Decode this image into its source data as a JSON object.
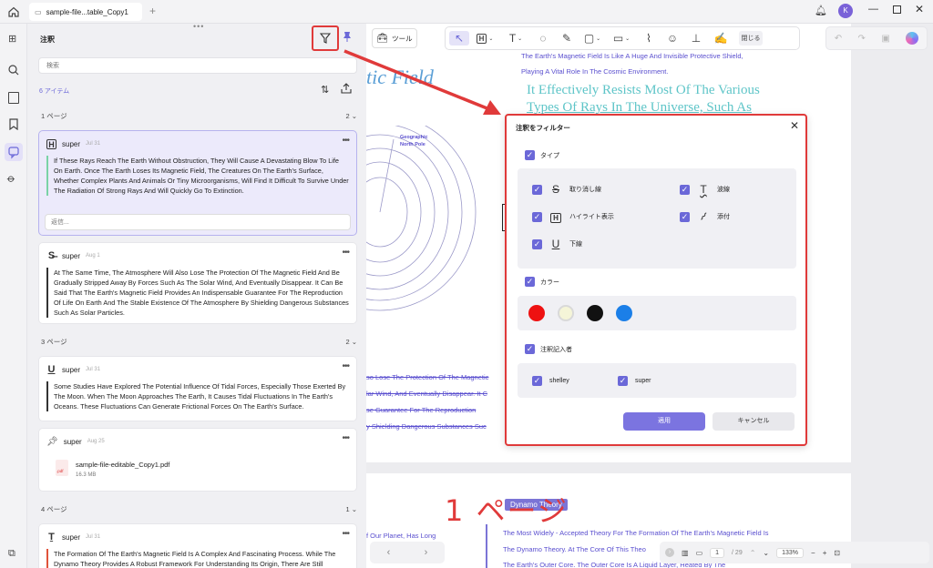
{
  "tab": {
    "title": "sample-file...table_Copy1",
    "new_tab": "+"
  },
  "user": {
    "initial": "K"
  },
  "panel": {
    "title": "注釈",
    "search_placeholder": "検索",
    "count": "6 アイテム",
    "sections": [
      {
        "label": "1 ページ",
        "count": "2"
      },
      {
        "label": "3 ページ",
        "count": "2"
      },
      {
        "label": "4 ページ",
        "count": "1"
      }
    ],
    "cards": [
      {
        "icon": "H",
        "author": "super",
        "date": "Jul 31",
        "body": "If These Rays Reach The Earth Without Obstruction, They Will Cause A Devastating Blow To Life On Earth. Once The Earth Loses Its Magnetic Field, The Creatures On The Earth's Surface, Whether Complex Plants And Animals Or Tiny Microorganisms, Will Find It Difficult To Survive Under The Radiation Of Strong Rays And Will Quickly Go To Extinction.",
        "reply_placeholder": "返信..."
      },
      {
        "icon": "S",
        "author": "super",
        "date": "Aug 1",
        "body": "At The Same Time, The Atmosphere Will Also Lose The Protection Of The Magnetic Field And Be Gradually Stripped Away By Forces Such As The Solar Wind, And Eventually Disappear. It Can Be Said That The Earth's Magnetic Field Provides An Indispensable Guarantee For The Reproduction Of Life On Earth And The Stable Existence Of The Atmosphere By Shielding Dangerous Substances Such As Solar Particles."
      },
      {
        "icon": "U",
        "author": "super",
        "date": "Jul 31",
        "body": "Some Studies Have Explored The Potential Influence Of Tidal Forces, Especially Those Exerted By The Moon. When The Moon Approaches The Earth, It Causes Tidal Fluctuations In The Earth's Oceans. These Fluctuations Can Generate Frictional Forces On The Earth's Surface."
      },
      {
        "icon": "pin",
        "author": "super",
        "date": "Aug 25",
        "file_name": "sample-file-editable_Copy1.pdf",
        "file_size": "16.3 MB",
        "file_ext": ".pdf"
      },
      {
        "icon": "T",
        "author": "super",
        "date": "Jul 31",
        "body": "The Formation Of The Earth's Magnetic Field Is A Complex And Fascinating Process. While The Dynamo Theory Provides A Robust Framework For Understanding Its Origin, There Are Still"
      }
    ]
  },
  "toolbar": {
    "tools_label": "ツール",
    "close_label": "閉じる"
  },
  "document": {
    "title_fragment": "tic Field",
    "small_line1": "The Earth's Magnetic Field Is Like A Huge And Invisible Protective Shield,",
    "small_line2": "Playing A Vital Role In The Cosmic Environment.",
    "big_line1": "It Effectively Resists Most Of The Various",
    "big_line2": "Types Of Rays In The Universe, Such As",
    "diagram_label1": "Geographic",
    "diagram_label2": "North Pole",
    "strike_lines": [
      "so Lose The Protection Of The Magnetic",
      "lar Wind, And Eventually Disappear. It C",
      "se Guarantee For The Reproduction",
      "y Shielding Dangerous Substances Suc"
    ],
    "page2_heading": "Dynamo Theory",
    "page2_left": "f Our Planet, Has Long",
    "page2_line1": "The Most Widely - Accepted Theory For The Formation Of The Earth's Magnetic Field Is",
    "page2_line2": "The Dynamo Theory. At The Core Of This Theo",
    "page2_line3": "The Earth's Outer Core. The Outer Core Is A Liquid Layer, Heated By The"
  },
  "annotation_overlay": {
    "page_label": "1 ページ"
  },
  "dialog": {
    "title": "注釈をフィルター",
    "type_label": "タイプ",
    "types": [
      {
        "label": "取り消し線",
        "icon": "S"
      },
      {
        "label": "波線",
        "icon": "T"
      },
      {
        "label": "ハイライト表示",
        "icon": "H"
      },
      {
        "label": "添付",
        "icon": "clip"
      },
      {
        "label": "下線",
        "icon": "U"
      }
    ],
    "color_label": "カラー",
    "colors": [
      "#ee1111",
      "#f5f5d8",
      "#111111",
      "#1b7fe8"
    ],
    "author_label": "注釈記入者",
    "authors": [
      "shelley",
      "super"
    ],
    "apply_label": "適用",
    "cancel_label": "キャンセル"
  },
  "status": {
    "page_current": "1",
    "page_total": "/ 29",
    "zoom": "133%"
  },
  "colors": {
    "accent": "#6b68d8",
    "highlight_red": "#e03a3a",
    "link_blue": "#5b9fd6"
  }
}
